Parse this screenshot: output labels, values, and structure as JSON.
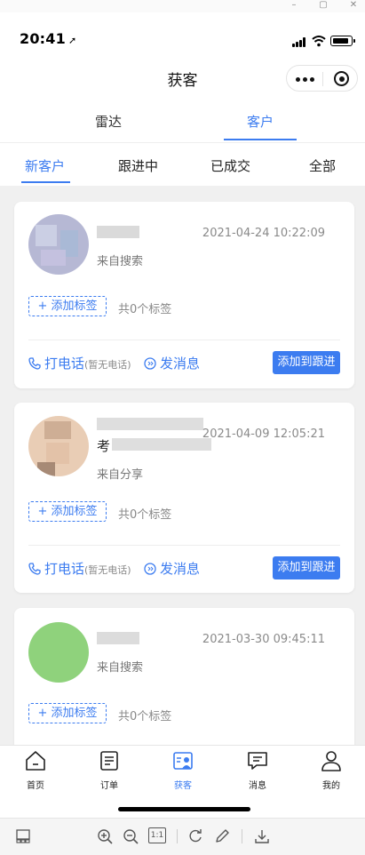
{
  "status": {
    "time": "20:41",
    "location_glyph": "➚"
  },
  "navbar": {
    "title": "获客"
  },
  "top_tabs": [
    {
      "label": "雷达"
    },
    {
      "label": "客户"
    }
  ],
  "sub_tabs": [
    {
      "label": "新客户"
    },
    {
      "label": "跟进中"
    },
    {
      "label": "已成交"
    },
    {
      "label": "全部"
    }
  ],
  "customers": [
    {
      "name_prefix": "",
      "date": "2021-04-24 10:22:09",
      "source": "来自搜索",
      "tag_button": "+ 添加标签",
      "tag_count": "共0个标签",
      "call_label": "打电话",
      "call_note": "(暂无电话)",
      "message_label": "发消息",
      "follow_button": "添加到跟进"
    },
    {
      "name_prefix": "考",
      "date": "2021-04-09 12:05:21",
      "source": "来自分享",
      "tag_button": "+ 添加标签",
      "tag_count": "共0个标签",
      "call_label": "打电话",
      "call_note": "(暂无电话)",
      "message_label": "发消息",
      "follow_button": "添加到跟进"
    },
    {
      "name_prefix": "",
      "date": "2021-03-30 09:45:11",
      "source": "来自搜索",
      "tag_button": "+ 添加标签",
      "tag_count": "共0个标签"
    }
  ],
  "tabbar": [
    {
      "label": "首页",
      "icon": "home-icon"
    },
    {
      "label": "订单",
      "icon": "order-icon"
    },
    {
      "label": "获客",
      "icon": "customer-icon",
      "active": true
    },
    {
      "label": "消息",
      "icon": "message-icon"
    },
    {
      "label": "我的",
      "icon": "profile-icon"
    }
  ],
  "viewer": {
    "zoom_reset": "1:1"
  },
  "colors": {
    "accent": "#3c7cf0"
  }
}
